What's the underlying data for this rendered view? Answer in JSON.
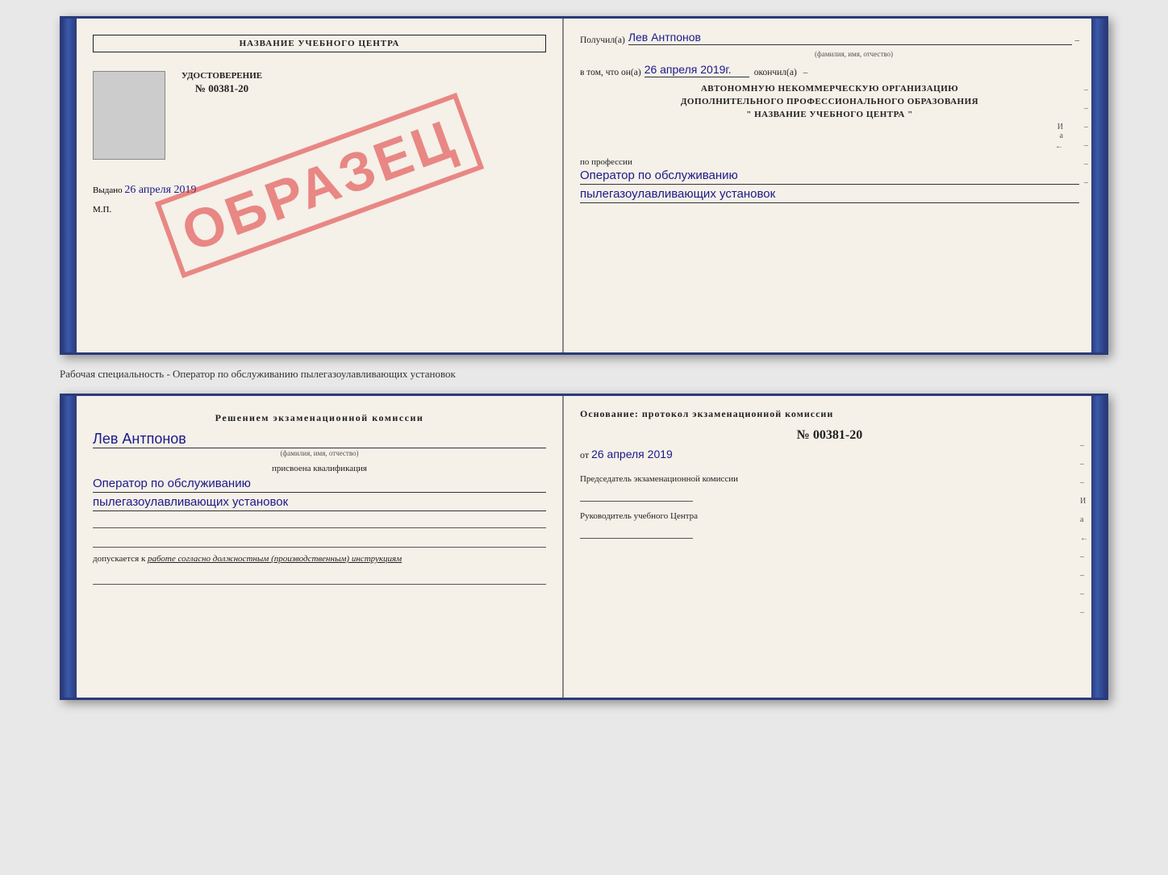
{
  "topCert": {
    "left": {
      "headerTitle": "НАЗВАНИЕ УЧЕБНОГО ЦЕНТРА",
      "docLabel": "УДОСТОВЕРЕНИЕ",
      "docNumber": "№ 00381-20",
      "issuedText": "Выдано",
      "issuedDate": "26 апреля 2019",
      "mpLabel": "М.П.",
      "stampText": "ОБРАЗЕЦ"
    },
    "right": {
      "receivedLabel": "Получил(а)",
      "receivedName": "Лев Антпонов",
      "nameSubLabel": "(фамилия, имя, отчество)",
      "inThatLabel": "в том, что он(а)",
      "completedDate": "26 апреля 2019г.",
      "completedLabel": "окончил(а)",
      "orgLine1": "АВТОНОМНУЮ НЕКОММЕРЧЕСКУЮ ОРГАНИЗАЦИЮ",
      "orgLine2": "ДОПОЛНИТЕЛЬНОГО ПРОФЕССИОНАЛЬНОГО ОБРАЗОВАНИЯ",
      "orgLine3": "\"  НАЗВАНИЕ УЧЕБНОГО ЦЕНТРА  \"",
      "professionLabel": "по профессии",
      "profession1": "Оператор по обслуживанию",
      "profession2": "пылегазоулавливающих установок"
    }
  },
  "middleLabel": "Рабочая специальность - Оператор по обслуживанию пылегазоулавливающих установок",
  "bottomCert": {
    "left": {
      "decisionTitle": "Решением экзаменационной комиссии",
      "personName": "Лев Антпонов",
      "nameSubLabel": "(фамилия, имя, отчество)",
      "assignedLabel": "присвоена квалификация",
      "qualification1": "Оператор по обслуживанию",
      "qualification2": "пылегазоулавливающих установок",
      "allowedLabel": "допускается к",
      "allowedItalic": "работе согласно должностным (производственным) инструкциям"
    },
    "right": {
      "basisLabel": "Основание: протокол экзаменационной комиссии",
      "protocolNumber": "№ 00381-20",
      "datePrefix": "от",
      "protocolDate": "26 апреля 2019",
      "chairLabel": "Председатель экзаменационной комиссии",
      "headLabel": "Руководитель учебного Центра"
    }
  }
}
